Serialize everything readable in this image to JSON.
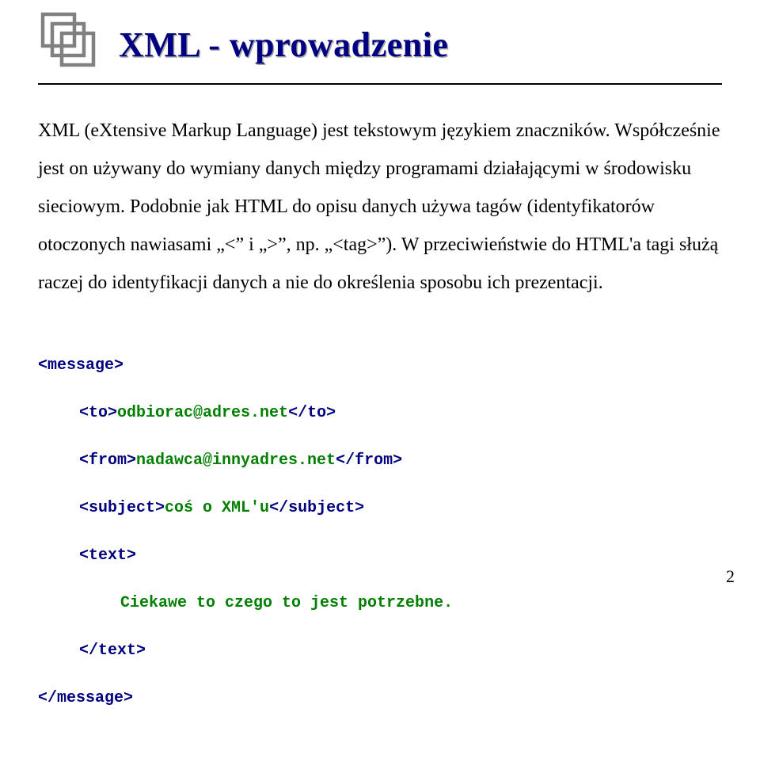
{
  "title": "XML - wprowadzenie",
  "body_text": "XML (eXtensive Markup Language) jest tekstowym językiem znaczników. Współcześnie jest on używany do wymiany danych między programami działającymi w środowisku sieciowym. Podobnie jak HTML do opisu danych używa tagów (identyfikatorów otoczonych nawiasami „<” i „>”, np. „<tag>”). W przeciwieństwie do HTML'a tagi służą raczej do identyfikacji danych a nie do określenia sposobu ich prezentacji.",
  "code": {
    "t1": "<message>",
    "t2a": "<to>",
    "t2b": "odbiorac@adres.net",
    "t2c": "</to>",
    "t3a": "<from>",
    "t3b": "nadawca@innyadres.net",
    "t3c": "</from>",
    "t4a": "<subject>",
    "t4b": "coś o XML'u",
    "t4c": "</subject>",
    "t5": "<text>",
    "t6": "Ciekawe to czego to jest potrzebne.",
    "t7": "</text>",
    "t8": "</message>"
  },
  "page_number": "2"
}
